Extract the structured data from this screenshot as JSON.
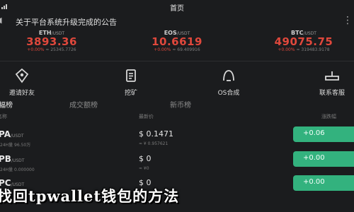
{
  "status_bar": {
    "title": "首页"
  },
  "notice": {
    "text": "关于平台系统升级完成的公告"
  },
  "tickers": [
    {
      "symbol": "ETH",
      "quote": "/USDT",
      "price": "3893.36",
      "change": "+0.00%",
      "volume": "≈ 25345.7726"
    },
    {
      "symbol": "EOS",
      "quote": "/USDT",
      "price": "10.6619",
      "change": "+0.00%",
      "volume": "≈ 69.409916"
    },
    {
      "symbol": "BTC",
      "quote": "/USDT",
      "price": "49075.75",
      "change": "+0.00%",
      "volume": "≈ 319483.9178"
    }
  ],
  "actions": [
    {
      "label": "邀请好友",
      "icon": "invite-icon"
    },
    {
      "label": "挖矿",
      "icon": "mining-icon"
    },
    {
      "label": "OS合成",
      "icon": "synthesis-icon"
    },
    {
      "label": "联系客服",
      "icon": "support-icon"
    }
  ],
  "tabs": [
    {
      "label": "涨幅榜",
      "active": true
    },
    {
      "label": "成交额榜",
      "active": false
    },
    {
      "label": "新币榜",
      "active": false
    }
  ],
  "columns": {
    "name": "名称",
    "price": "最新价",
    "change": "涨跌幅"
  },
  "rows": [
    {
      "symbol": "PA",
      "quote": "/USDT",
      "volume": "24H量 96.50万",
      "price": "$ 0.1471",
      "cny": "≈ ¥ 0.957621",
      "change": "+0.06"
    },
    {
      "symbol": "PB",
      "quote": "/USDT",
      "volume": "24H量 0.000000",
      "price": "$ 0",
      "cny": "≈ ¥0",
      "change": "+0.00"
    },
    {
      "symbol": "PC",
      "quote": "/USDT",
      "volume": "",
      "price": "$ 0",
      "cny": "",
      "change": "+0.00"
    }
  ],
  "banner": {
    "text": "找回tpwallet钱包的方法"
  },
  "colors": {
    "background": "#1b1c1e",
    "down_red": "#e0483c",
    "up_green": "#33b27e"
  }
}
